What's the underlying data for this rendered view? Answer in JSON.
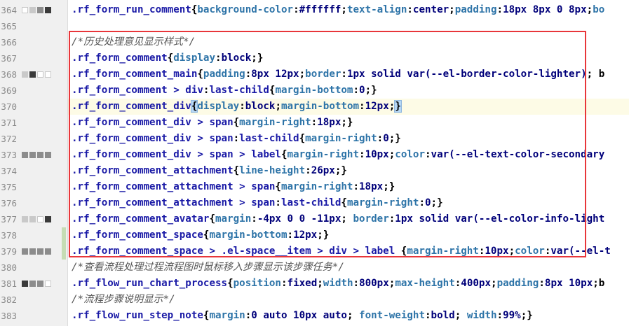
{
  "editor": {
    "colors": {
      "selector": "#1a1aa6",
      "property": "#2e74a8",
      "value": "#00007a",
      "comment": "#555555",
      "current_line": "#fdfbe6",
      "highlight_box": "#e8363a"
    },
    "lines": [
      {
        "num": "364",
        "markers": [
          "w",
          "l",
          "m",
          "d"
        ],
        "changed": false,
        "tokens": [
          [
            "sel",
            ".rf_form_run_comment"
          ],
          [
            "punc",
            "{"
          ],
          [
            "prop",
            "background-color"
          ],
          [
            "punc",
            ":"
          ],
          [
            "val",
            "#ffffff"
          ],
          [
            "punc",
            ";"
          ],
          [
            "prop",
            "text-align"
          ],
          [
            "punc",
            ":"
          ],
          [
            "val",
            "center"
          ],
          [
            "punc",
            ";"
          ],
          [
            "prop",
            "padding"
          ],
          [
            "punc",
            ":"
          ],
          [
            "num",
            "18px 8px 0 8px"
          ],
          [
            "punc",
            ";"
          ],
          [
            "prop",
            "bo"
          ]
        ]
      },
      {
        "num": "365",
        "markers": [],
        "changed": false,
        "tokens": []
      },
      {
        "num": "366",
        "markers": [],
        "changed": false,
        "tokens": [
          [
            "cmt",
            "/*历史处理意见显示样式*/"
          ]
        ]
      },
      {
        "num": "367",
        "markers": [],
        "changed": false,
        "tokens": [
          [
            "sel",
            ".rf_form_comment"
          ],
          [
            "punc",
            "{"
          ],
          [
            "prop",
            "display"
          ],
          [
            "punc",
            ":"
          ],
          [
            "val",
            "block"
          ],
          [
            "punc",
            ";}"
          ]
        ]
      },
      {
        "num": "368",
        "markers": [
          "l",
          "d",
          "w",
          "w"
        ],
        "changed": false,
        "tokens": [
          [
            "sel",
            ".rf_form_comment_main"
          ],
          [
            "punc",
            "{"
          ],
          [
            "prop",
            "padding"
          ],
          [
            "punc",
            ":"
          ],
          [
            "num",
            "8px 12px"
          ],
          [
            "punc",
            ";"
          ],
          [
            "prop",
            "border"
          ],
          [
            "punc",
            ":"
          ],
          [
            "num",
            "1px"
          ],
          [
            "val",
            " solid var(--el-border-color-lighter)"
          ],
          [
            "punc",
            "; b"
          ]
        ]
      },
      {
        "num": "369",
        "markers": [],
        "changed": false,
        "tokens": [
          [
            "sel",
            ".rf_form_comment > div"
          ],
          [
            "punc",
            ":"
          ],
          [
            "sel",
            "last-child"
          ],
          [
            "punc",
            "{"
          ],
          [
            "prop",
            "margin-bottom"
          ],
          [
            "punc",
            ":"
          ],
          [
            "num",
            "0"
          ],
          [
            "punc",
            ";}"
          ]
        ]
      },
      {
        "num": "370",
        "markers": [],
        "changed": false,
        "current": true,
        "tokens": [
          [
            "sel",
            ".rf_form_comment_div"
          ],
          [
            "hl",
            "{"
          ],
          [
            "prop",
            "display"
          ],
          [
            "punc",
            ":"
          ],
          [
            "val",
            "block"
          ],
          [
            "punc",
            ";"
          ],
          [
            "prop",
            "margin-bottom"
          ],
          [
            "punc",
            ":"
          ],
          [
            "num",
            "12px"
          ],
          [
            "punc",
            ";"
          ],
          [
            "hl",
            "}"
          ]
        ]
      },
      {
        "num": "371",
        "markers": [],
        "changed": false,
        "tokens": [
          [
            "sel",
            ".rf_form_comment_div > span"
          ],
          [
            "punc",
            "{"
          ],
          [
            "prop",
            "margin-right"
          ],
          [
            "punc",
            ":"
          ],
          [
            "num",
            "18px"
          ],
          [
            "punc",
            ";}"
          ]
        ]
      },
      {
        "num": "372",
        "markers": [],
        "changed": false,
        "tokens": [
          [
            "sel",
            ".rf_form_comment_div > span"
          ],
          [
            "punc",
            ":"
          ],
          [
            "sel",
            "last-child"
          ],
          [
            "punc",
            "{"
          ],
          [
            "prop",
            "margin-right"
          ],
          [
            "punc",
            ":"
          ],
          [
            "num",
            "0"
          ],
          [
            "punc",
            ";}"
          ]
        ]
      },
      {
        "num": "373",
        "markers": [
          "m",
          "m",
          "m",
          "m"
        ],
        "changed": false,
        "tokens": [
          [
            "sel",
            ".rf_form_comment_div > span > label"
          ],
          [
            "punc",
            "{"
          ],
          [
            "prop",
            "margin-right"
          ],
          [
            "punc",
            ":"
          ],
          [
            "num",
            "10px"
          ],
          [
            "punc",
            ";"
          ],
          [
            "prop",
            "color"
          ],
          [
            "punc",
            ":"
          ],
          [
            "val",
            "var(--el-text-color-secondary"
          ]
        ]
      },
      {
        "num": "374",
        "markers": [],
        "changed": false,
        "tokens": [
          [
            "sel",
            ".rf_form_comment_attachment"
          ],
          [
            "punc",
            "{"
          ],
          [
            "prop",
            "line-height"
          ],
          [
            "punc",
            ":"
          ],
          [
            "num",
            "26px"
          ],
          [
            "punc",
            ";}"
          ]
        ]
      },
      {
        "num": "375",
        "markers": [],
        "changed": false,
        "tokens": [
          [
            "sel",
            ".rf_form_comment_attachment > span"
          ],
          [
            "punc",
            "{"
          ],
          [
            "prop",
            "margin-right"
          ],
          [
            "punc",
            ":"
          ],
          [
            "num",
            "18px"
          ],
          [
            "punc",
            ";}"
          ]
        ]
      },
      {
        "num": "376",
        "markers": [],
        "changed": false,
        "tokens": [
          [
            "sel",
            ".rf_form_comment_attachment > span"
          ],
          [
            "punc",
            ":"
          ],
          [
            "sel",
            "last-child"
          ],
          [
            "punc",
            "{"
          ],
          [
            "prop",
            "margin-right"
          ],
          [
            "punc",
            ":"
          ],
          [
            "num",
            "0"
          ],
          [
            "punc",
            ";}"
          ]
        ]
      },
      {
        "num": "377",
        "markers": [
          "l",
          "l",
          "w",
          "d"
        ],
        "changed": false,
        "tokens": [
          [
            "sel",
            ".rf_form_comment_avatar"
          ],
          [
            "punc",
            "{"
          ],
          [
            "prop",
            "margin"
          ],
          [
            "punc",
            ":"
          ],
          [
            "num",
            "-4px 0 0 -11px"
          ],
          [
            "punc",
            "; "
          ],
          [
            "prop",
            "border"
          ],
          [
            "punc",
            ":"
          ],
          [
            "num",
            "1px"
          ],
          [
            "val",
            " solid var(--el-color-info-light"
          ]
        ]
      },
      {
        "num": "378",
        "markers": [],
        "changed": true,
        "tokens": [
          [
            "sel",
            ".rf_form_comment_space"
          ],
          [
            "punc",
            "{"
          ],
          [
            "prop",
            "margin-bottom"
          ],
          [
            "punc",
            ":"
          ],
          [
            "num",
            "12px"
          ],
          [
            "punc",
            ";}"
          ]
        ]
      },
      {
        "num": "379",
        "markers": [
          "m",
          "m",
          "m",
          "m"
        ],
        "changed": true,
        "tokens": [
          [
            "sel",
            ".rf_form_comment_space > .el-space__item > div > label "
          ],
          [
            "punc",
            "{"
          ],
          [
            "prop",
            "margin-right"
          ],
          [
            "punc",
            ":"
          ],
          [
            "num",
            "10px"
          ],
          [
            "punc",
            ";"
          ],
          [
            "prop",
            "color"
          ],
          [
            "punc",
            ":"
          ],
          [
            "val",
            "var(--el-t"
          ]
        ]
      },
      {
        "num": "380",
        "markers": [],
        "changed": false,
        "tokens": [
          [
            "cmt",
            "/*查看流程处理过程流程图时鼠标移入步骤显示该步骤任务*/"
          ]
        ]
      },
      {
        "num": "381",
        "markers": [
          "d",
          "m",
          "m",
          "w"
        ],
        "changed": false,
        "tokens": [
          [
            "sel",
            ".rf_flow_run_chart_process"
          ],
          [
            "punc",
            "{"
          ],
          [
            "prop",
            "position"
          ],
          [
            "punc",
            ":"
          ],
          [
            "val",
            "fixed"
          ],
          [
            "punc",
            ";"
          ],
          [
            "prop",
            "width"
          ],
          [
            "punc",
            ":"
          ],
          [
            "num",
            "800px"
          ],
          [
            "punc",
            ";"
          ],
          [
            "prop",
            "max-height"
          ],
          [
            "punc",
            ":"
          ],
          [
            "num",
            "400px"
          ],
          [
            "punc",
            ";"
          ],
          [
            "prop",
            "padding"
          ],
          [
            "punc",
            ":"
          ],
          [
            "num",
            "8px 10px"
          ],
          [
            "punc",
            ";b"
          ]
        ]
      },
      {
        "num": "382",
        "markers": [],
        "changed": false,
        "tokens": [
          [
            "cmt",
            "/*流程步骤说明显示*/"
          ]
        ]
      },
      {
        "num": "383",
        "markers": [],
        "changed": false,
        "tokens": [
          [
            "sel",
            ".rf_flow_run_step_note"
          ],
          [
            "punc",
            "{"
          ],
          [
            "prop",
            "margin"
          ],
          [
            "punc",
            ":"
          ],
          [
            "num",
            "0 auto 10px auto"
          ],
          [
            "punc",
            "; "
          ],
          [
            "prop",
            "font-weight"
          ],
          [
            "punc",
            ":"
          ],
          [
            "val",
            "bold"
          ],
          [
            "punc",
            "; "
          ],
          [
            "prop",
            "width"
          ],
          [
            "punc",
            ":"
          ],
          [
            "num",
            "99%"
          ],
          [
            "punc",
            ";}"
          ]
        ]
      }
    ]
  }
}
